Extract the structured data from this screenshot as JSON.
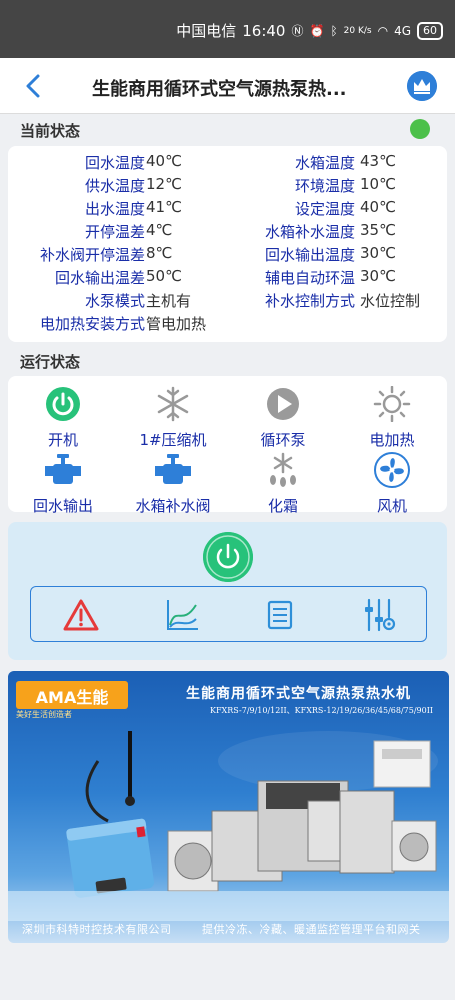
{
  "status_bar": {
    "carrier": "中国电信",
    "time": "16:40",
    "net_speed": "20 K/s",
    "network": "4G",
    "battery": "60"
  },
  "header": {
    "title": "生能商用循环式空气源热泵热..."
  },
  "current_status": {
    "title": "当前状态",
    "online_color": "#4cc04a",
    "rows": [
      {
        "l1": "回水温度",
        "v1": "40℃",
        "l2": "水箱温度",
        "v2": "43℃"
      },
      {
        "l1": "供水温度",
        "v1": "12℃",
        "l2": "环境温度",
        "v2": "10℃"
      },
      {
        "l1": "出水温度",
        "v1": "41℃",
        "l2": "设定温度",
        "v2": "40℃"
      },
      {
        "l1": "开停温差",
        "v1": "4℃",
        "l2": "水箱补水温度",
        "v2": "35℃"
      },
      {
        "l1": "补水阀开停温差",
        "v1": "8℃",
        "l2": "回水输出温度",
        "v2": "30℃"
      },
      {
        "l1": "回水输出温差",
        "v1": "50℃",
        "l2": "辅电自动环温",
        "v2": "30℃"
      },
      {
        "l1": "水泵模式",
        "v1": "主机有",
        "l2": "补水控制方式",
        "v2": "水位控制"
      },
      {
        "l1": "电加热安装方式",
        "v1": "管电加热",
        "l2": "",
        "v2": ""
      }
    ]
  },
  "run_status": {
    "title": "运行状态",
    "items": [
      {
        "label": "开机",
        "icon": "power-on-icon"
      },
      {
        "label": "1#压缩机",
        "icon": "snowflake-icon"
      },
      {
        "label": "循环泵",
        "icon": "pump-play-icon"
      },
      {
        "label": "电加热",
        "icon": "sun-icon"
      },
      {
        "label": "回水输出",
        "icon": "valve-icon"
      },
      {
        "label": "水箱补水阀",
        "icon": "valve-icon"
      },
      {
        "label": "化霜",
        "icon": "defrost-icon"
      },
      {
        "label": "风机",
        "icon": "fan-icon"
      }
    ]
  },
  "controls": {
    "power_color": "#27c27a",
    "tools": [
      "alarm-icon",
      "chart-icon",
      "list-icon",
      "settings-sliders-icon"
    ]
  },
  "banner": {
    "logo_text": "AMA生能",
    "slogan": "美好生活创造者",
    "title": "生能商用循环式空气源热泵热水机",
    "models": "KFXRS-7/9/10/12II、KFXRS-12/19/26/36/45/68/75/90II",
    "footer_left": "深圳市科特时控技术有限公司",
    "footer_right": "提供冷冻、冷藏、暖通监控管理平台和网关"
  }
}
